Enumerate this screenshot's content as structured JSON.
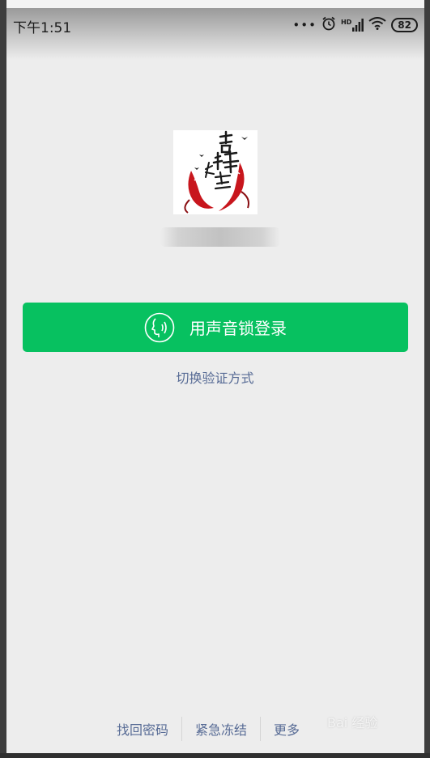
{
  "status_bar": {
    "time": "下午1:51",
    "dots": "•••",
    "signal_label": "HD",
    "battery_level": "82",
    "icons": [
      "alarm-icon",
      "hd-signal-icon",
      "wifi-icon",
      "battery-icon"
    ]
  },
  "profile": {
    "avatar_icon": "koi-fish-avatar",
    "avatar_text": "吉祥如意",
    "username_obscured": true
  },
  "login": {
    "voice_button_label": "用声音锁登录",
    "voice_icon": "voice-lock-icon",
    "switch_method_label": "切换验证方式"
  },
  "footer": {
    "links": [
      "找回密码",
      "紧急冻结",
      "更多"
    ]
  },
  "watermark": {
    "text": "Bai 经验"
  },
  "colors": {
    "accent": "#07c160",
    "link": "#576b95",
    "background": "#ededed"
  }
}
